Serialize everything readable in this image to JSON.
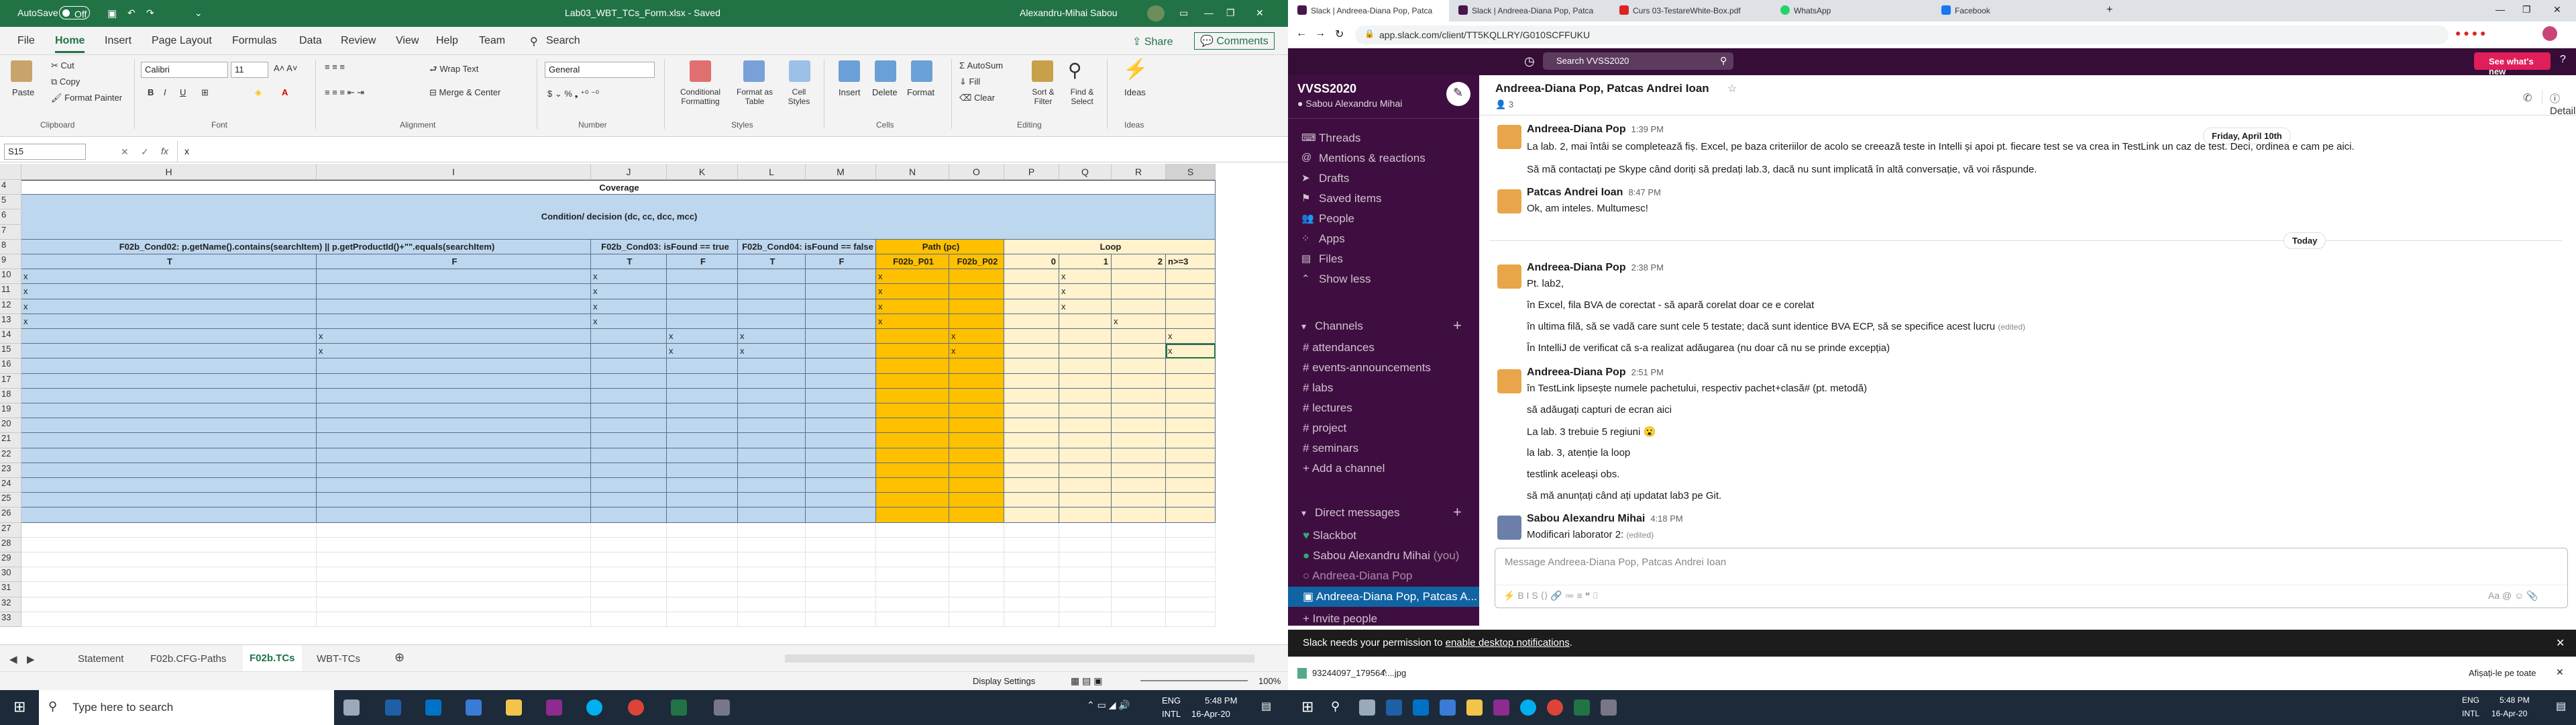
{
  "excel": {
    "autosave": "AutoSave",
    "autosave_state": "Off",
    "title": "Lab03_WBT_TCs_Form.xlsx - Saved",
    "user": "Alexandru-Mihai Sabou",
    "tabs": [
      "File",
      "Home",
      "Insert",
      "Page Layout",
      "Formulas",
      "Data",
      "Review",
      "View",
      "Help",
      "Team"
    ],
    "search": "Search",
    "share": "Share",
    "comments": "Comments",
    "ribbon": {
      "paste": "Paste",
      "cut": "Cut",
      "copy": "Copy",
      "format_painter": "Format Painter",
      "clipboard": "Clipboard",
      "font_name": "Calibri",
      "font_size": "11",
      "font": "Font",
      "wrap": "Wrap Text",
      "merge": "Merge & Center",
      "alignment": "Alignment",
      "number_format": "General",
      "number": "Number",
      "cond": "Conditional Formatting",
      "fmt_table": "Format as Table",
      "cell_styles": "Cell Styles",
      "styles": "Styles",
      "insert": "Insert",
      "delete": "Delete",
      "format": "Format",
      "cells": "Cells",
      "autosum": "AutoSum",
      "fill": "Fill",
      "clear": "Clear",
      "sort": "Sort & Filter",
      "find": "Find & Select",
      "editing": "Editing",
      "ideas": "Ideas",
      "ideas_grp": "Ideas"
    },
    "namebox": "S15",
    "formula": "x",
    "columns": [
      "H",
      "I",
      "J",
      "K",
      "L",
      "M",
      "N",
      "O",
      "P",
      "Q",
      "R",
      "S"
    ],
    "rows": [
      "4",
      "5",
      "6",
      "7",
      "8",
      "9",
      "10",
      "11",
      "12",
      "13",
      "14",
      "15",
      "16",
      "17",
      "18",
      "19",
      "20",
      "21",
      "22",
      "23",
      "24",
      "25",
      "26",
      "27",
      "28",
      "29",
      "30",
      "31",
      "32",
      "33"
    ],
    "coverage": "Coverage",
    "condition": "Condition/ decision (dc, cc, dcc, mcc)",
    "hdr8": [
      "F02b_Cond02: p.getName().contains(searchItem) || p.getProductId()+\"\".equals(searchItem)",
      "F02b_Cond03: isFound == true",
      "F02b_Cond04: isFound == false",
      "Path (pc)",
      "Loop"
    ],
    "hdr9": [
      "T",
      "F",
      "T",
      "F",
      "T",
      "F",
      "F02b_P01",
      "F02b_P02",
      "0",
      "1",
      "2",
      "n>=3"
    ],
    "mark": "x",
    "sheets": [
      "Statement",
      "F02b.CFG-Paths",
      "F02b.TCs",
      "WBT-TCs"
    ],
    "display": "Display Settings",
    "zoom": "100%"
  },
  "taskbar_left": {
    "search": "Type here to search",
    "lang": "ENG",
    "region": "INTL",
    "time": "5:48 PM",
    "date": "16-Apr-20"
  },
  "chrome": {
    "tabs": [
      "Slack | Andreea-Diana Pop, Patca",
      "Slack | Andreea-Diana Pop, Patca",
      "Curs 03-TestareWhite-Box.pdf",
      "WhatsApp",
      "Facebook"
    ],
    "url": "app.slack.com/client/TT5KQLLRY/G010SCFFUKU"
  },
  "slack": {
    "search": "Search VVSS2020",
    "whats_new": "See what's new",
    "workspace": "VVSS2020",
    "user": "Sabou Alexandru Mihai",
    "nav": [
      "Threads",
      "Mentions & reactions",
      "Drafts",
      "Saved items",
      "People",
      "Apps",
      "Files",
      "Show less"
    ],
    "channels_hdr": "Channels",
    "channels": [
      "attendances",
      "events-announcements",
      "labs",
      "lectures",
      "project",
      "seminars"
    ],
    "add_channel": "Add a channel",
    "dm_hdr": "Direct messages",
    "dms": [
      "Slackbot",
      "Sabou Alexandru Mihai",
      "Andreea-Diana Pop",
      "Andreea-Diana Pop, Patcas A..."
    ],
    "you": "(you)",
    "invite": "Invite people",
    "chat_title": "Andreea-Diana Pop, Patcas Andrei Ioan",
    "members": "3",
    "details": "Details",
    "day_old": "Friday, April 10th",
    "today": "Today",
    "m1": {
      "name": "Andreea-Diana Pop",
      "time": "1:39 PM",
      "l1": "La lab. 2, mai întâi se completează fiș. Excel, pe baza criteriilor de acolo se creează teste in Intelli și apoi pt. fiecare test se va crea in TestLink un caz de test. Deci, ordinea e cam pe aici.",
      "l2": "Să mă contactați pe Skype când doriți să predați lab.3, dacă nu sunt implicată în altă conversație, vă voi răspunde."
    },
    "m2": {
      "name": "Patcas Andrei Ioan",
      "time": "8:47 PM",
      "l1": "Ok, am inteles. Multumesc!"
    },
    "m3": {
      "name": "Andreea-Diana Pop",
      "time": "2:38 PM",
      "l1": "Pt. lab2,",
      "l2": "în Excel, fila BVA de corectat - să apară corelat doar ce e corelat",
      "l3": "în ultima filă, să se vadă care sunt cele 5 testate; dacă sunt identice BVA ECP, să se specifice acest lucru",
      "edited": "(edited)",
      "l4": "În IntelliJ de verificat că s-a realizat adăugarea (nu doar că nu se prinde excepția)"
    },
    "m4": {
      "name": "Andreea-Diana Pop",
      "time": "2:51 PM",
      "l1": "în TestLink lipsește numele pachetului, respectiv pachet+clasă# (pt. metodă)",
      "l2": "să adăugați capturi de ecran aici",
      "l3": "La lab. 3 trebuie 5 regiuni",
      "l4": "la lab. 3, atenție la loop",
      "l5": "testlink aceleași obs.",
      "l6": "să mă anunțați când ați updatat lab3 pe Git."
    },
    "m5": {
      "name": "Sabou Alexandru Mihai",
      "time": "4:18 PM",
      "l1": "Modificari laborator 2:",
      "edited": "(edited)"
    },
    "composer": "Message Andreea-Diana Pop, Patcas Andrei Ioan",
    "notice": "Slack needs your permission to",
    "notice_link": "enable desktop notifications",
    "download": "93244097_179564....jpg",
    "show_all": "Afișați-le pe toate"
  },
  "taskbar_right": {
    "lang": "ENG",
    "region": "INTL",
    "time": "5:48 PM",
    "date": "16-Apr-20"
  }
}
